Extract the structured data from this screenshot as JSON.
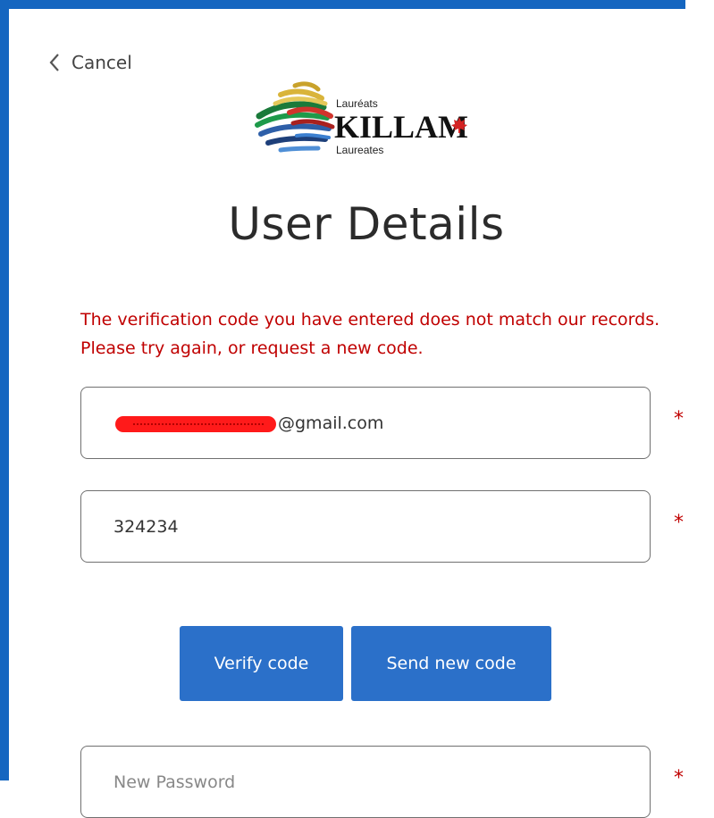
{
  "header": {
    "cancel_label": "Cancel"
  },
  "logo": {
    "top_text": "Lauréats",
    "main_text": "KILLAM",
    "bottom_text": "Laureates"
  },
  "page": {
    "title": "User Details"
  },
  "error": {
    "message": "The verification code you have entered does not match our records. Please try again, or request a new code."
  },
  "form": {
    "email_value_suffix": "@gmail.com",
    "code_value": "324234",
    "password_placeholder": "New Password",
    "required_marker": "*"
  },
  "buttons": {
    "verify_label": "Verify code",
    "send_label": "Send new code"
  },
  "colors": {
    "accent": "#2b70c9",
    "border": "#1566c0",
    "error": "#c00000"
  },
  "icons": {
    "cancel": "chevron-left-icon",
    "maple_leaf": "maple-leaf-icon"
  }
}
